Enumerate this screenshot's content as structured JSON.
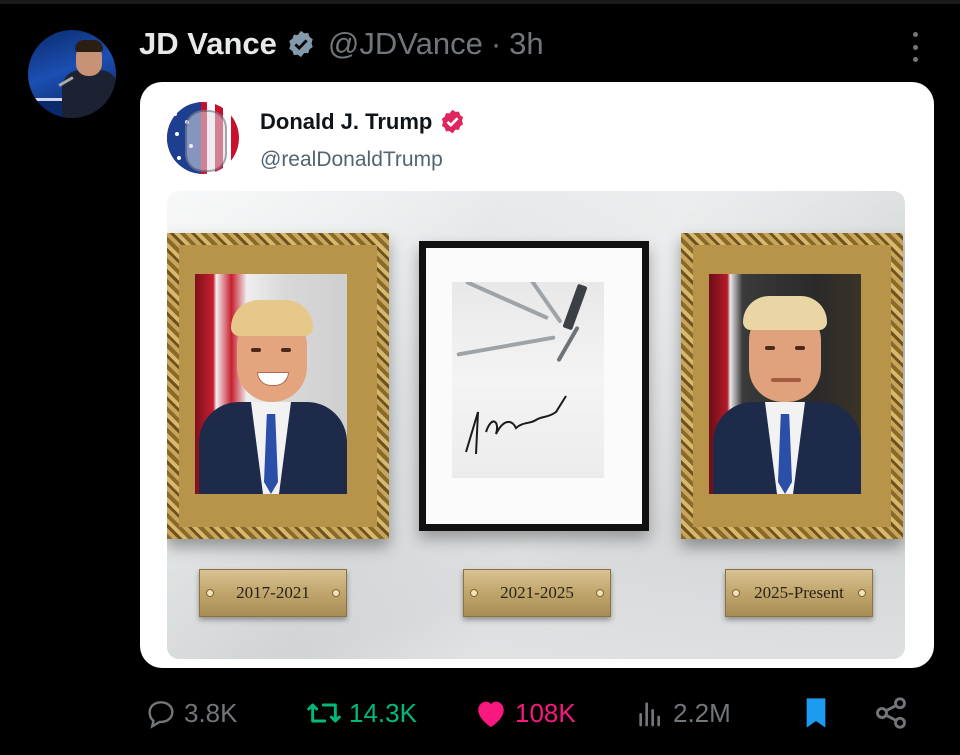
{
  "post": {
    "author_name": "JD Vance",
    "author_handle": "@JDVance",
    "separator": "·",
    "time": "3h"
  },
  "quoted": {
    "author_name": "Donald J. Trump",
    "author_handle": "@realDonaldTrump",
    "plaques": [
      "2017-2021",
      "2021-2025",
      "2025-Present"
    ]
  },
  "actions": {
    "replies": "3.8K",
    "reposts": "14.3K",
    "likes": "108K",
    "views": "2.2M"
  },
  "colors": {
    "background": "#000000",
    "muted": "#71767b",
    "repost_green": "#00ba7c",
    "like_pink": "#f91880",
    "bookmark_blue": "#1d9bf0",
    "verified_gray": "#829aab",
    "verified_pink": "#e0245e"
  },
  "icons": [
    "more-icon",
    "verified-badge-icon",
    "reply-icon",
    "repost-icon",
    "like-icon",
    "views-icon",
    "bookmark-icon",
    "share-icon"
  ]
}
